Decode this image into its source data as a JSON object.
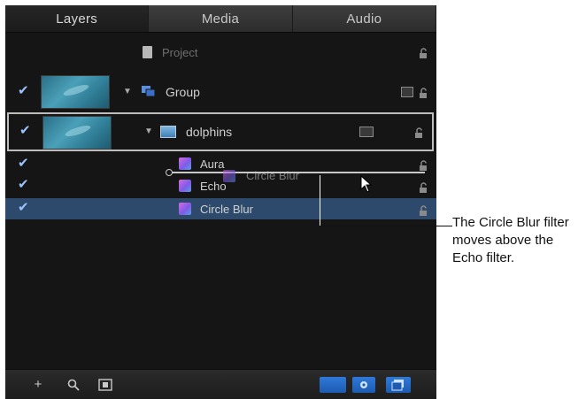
{
  "tabs": [
    {
      "label": "Layers"
    },
    {
      "label": "Media"
    },
    {
      "label": "Audio"
    }
  ],
  "layers": {
    "project": {
      "label": "Project"
    },
    "group": {
      "label": "Group"
    },
    "dolphins": {
      "label": "dolphins"
    },
    "filters": [
      {
        "label": "Aura",
        "checked": true
      },
      {
        "label": "Echo",
        "checked": true
      },
      {
        "label": "Circle Blur",
        "checked": true,
        "selected": true
      }
    ],
    "drag_ghost": {
      "label": "Circle Blur"
    }
  },
  "callout": {
    "text": "The Circle Blur filter moves above the Echo filter."
  },
  "bottom_bar": {
    "add_icon": "plus-icon",
    "search_icon": "search-icon",
    "export_icon": "frame-icon"
  },
  "colors": {
    "panel_bg": "#151515",
    "selection": "#2d4a6c",
    "accent_blue": "#2f79d8",
    "check_blue": "#9cc3ff"
  }
}
